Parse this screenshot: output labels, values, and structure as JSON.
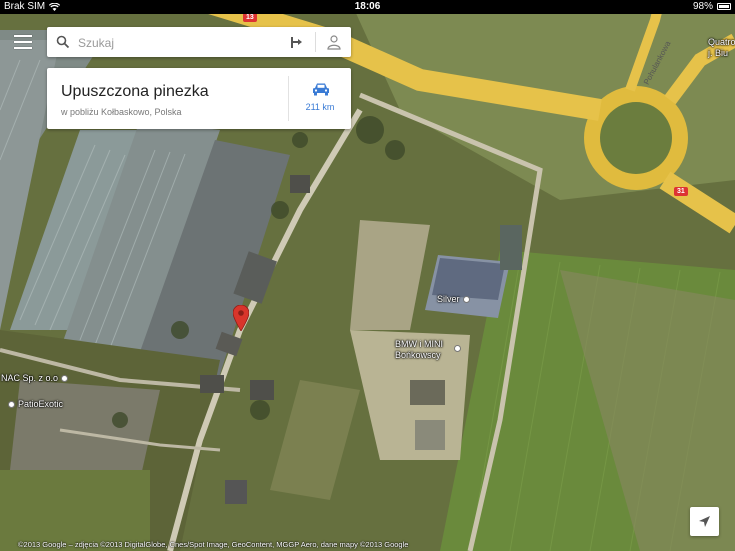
{
  "status_bar": {
    "carrier": "Brak SIM",
    "time": "18:06",
    "battery": "98%"
  },
  "search": {
    "placeholder": "Szukaj"
  },
  "place_card": {
    "title": "Upuszczona pinezka",
    "subtitle": "w pobliżu Kołbaskowo, Polska",
    "distance": "211 km"
  },
  "map_labels": {
    "poi_nac": "NAC Sp. z o.o",
    "poi_patio": "PatioExotic",
    "poi_silver": "Silver",
    "poi_bmw_line1": "BMW i MINI",
    "poi_bmw_line2": "Bońkowscy",
    "street_pohulankowa": "Pohulankowa",
    "road_13": "13",
    "road_31": "31",
    "edge_label_1": "Quatro",
    "edge_label_2": "j. Biu"
  },
  "copyright": "©2013 Google – zdjęcia ©2013 DigitalGlobe, Cnes/Spot Image, GeoContent, MGGP Aero, dane mapy ©2013 Google",
  "icons": {
    "menu": "menu-icon",
    "search": "search-icon",
    "directions": "directions-icon",
    "account": "account-icon",
    "car": "car-icon",
    "locate": "location-arrow-icon",
    "pin": "red-map-pin-icon"
  },
  "colors": {
    "route_blue": "#3a7bd5",
    "pin_red": "#d9352b",
    "road_yellow": "#e6c24a"
  }
}
